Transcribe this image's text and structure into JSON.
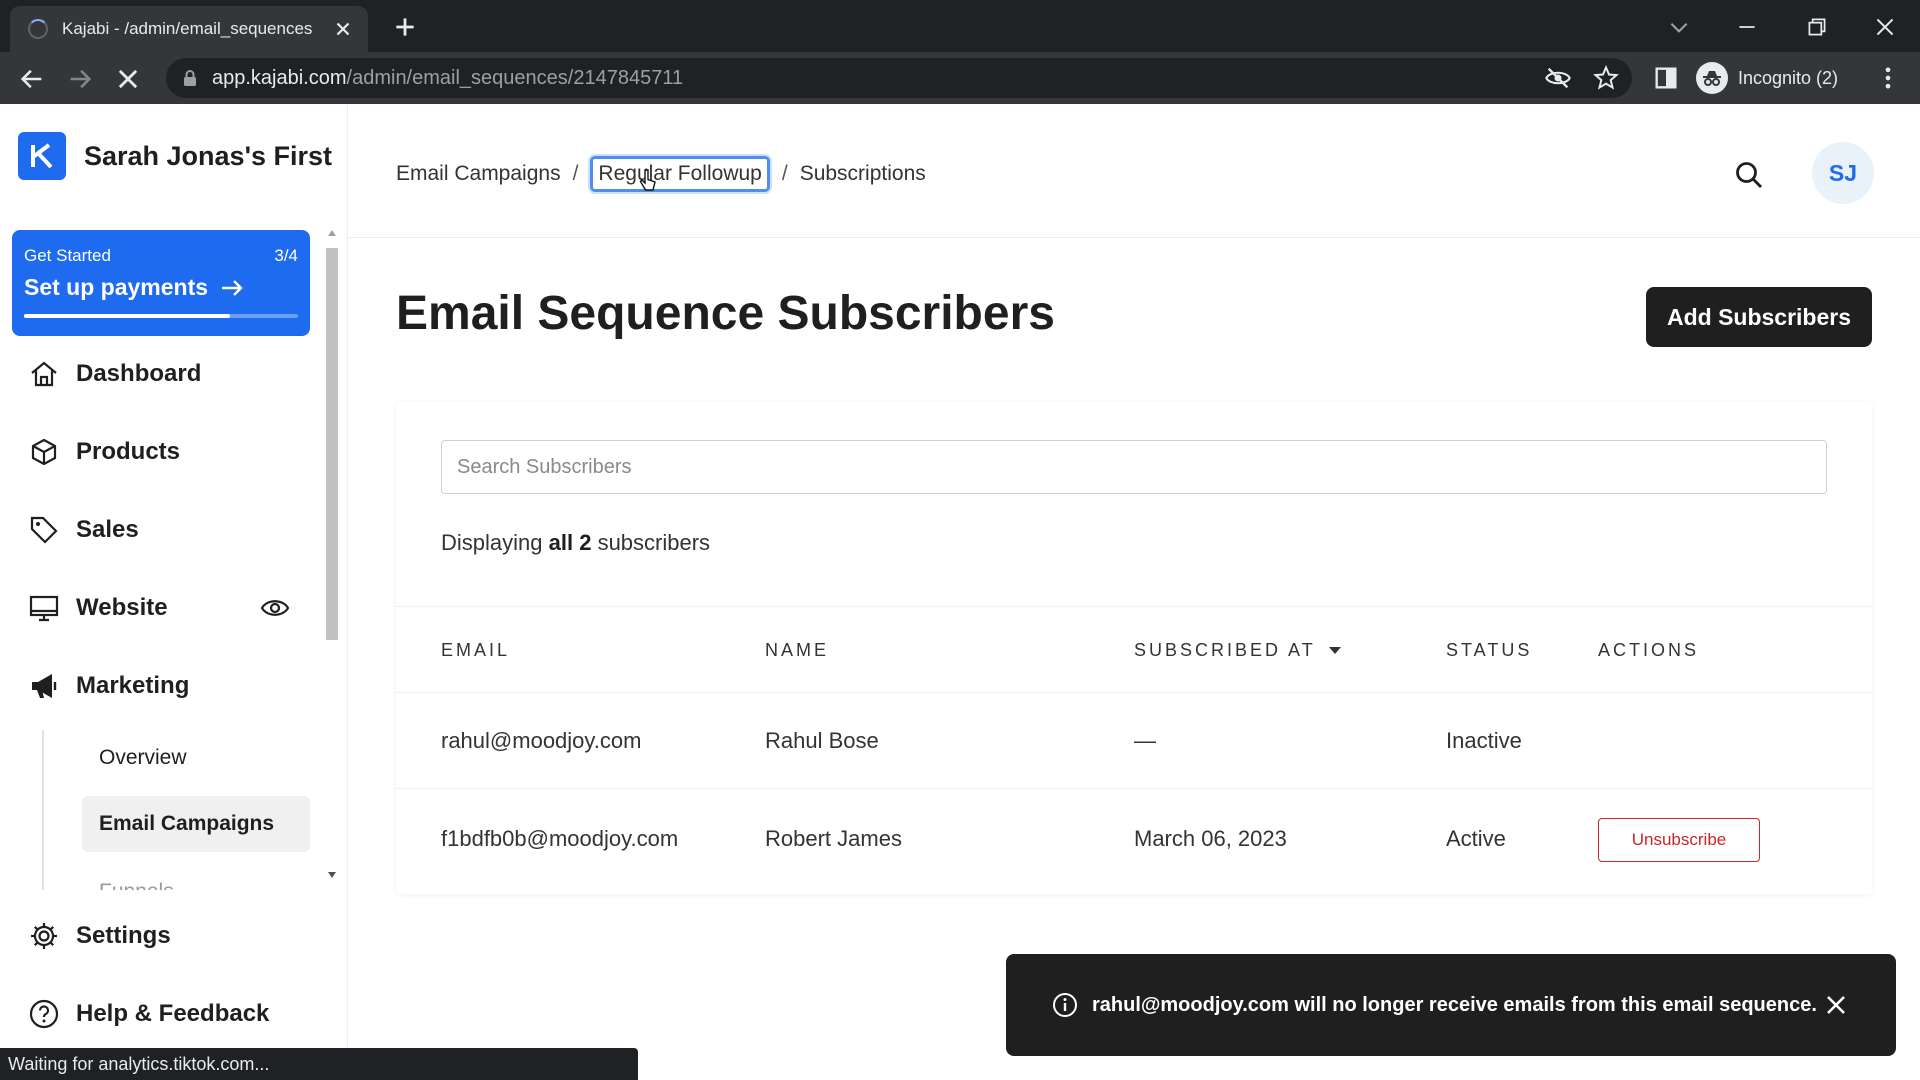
{
  "browser": {
    "tab_title": "Kajabi - /admin/email_sequences",
    "url_host": "app.kajabi.com",
    "url_path": "/admin/email_sequences/2147845711",
    "incognito_label": "Incognito (2)",
    "status_text": "Waiting for analytics.tiktok.com..."
  },
  "sidebar": {
    "site_name": "Sarah Jonas's First",
    "get_started": {
      "label": "Get Started",
      "progress": "3/4",
      "progress_fraction": 0.75,
      "cta": "Set up payments"
    },
    "nav": [
      {
        "label": "Dashboard",
        "icon": "home-icon"
      },
      {
        "label": "Products",
        "icon": "cube-icon"
      },
      {
        "label": "Sales",
        "icon": "tag-icon"
      },
      {
        "label": "Website",
        "icon": "monitor-icon"
      },
      {
        "label": "Marketing",
        "icon": "megaphone-icon"
      }
    ],
    "marketing_sub": [
      {
        "label": "Overview"
      },
      {
        "label": "Email Campaigns"
      },
      {
        "label": "Funnels"
      }
    ],
    "bottom": [
      {
        "label": "Settings",
        "icon": "gear-icon"
      },
      {
        "label": "Help & Feedback",
        "icon": "help-icon"
      }
    ]
  },
  "header": {
    "breadcrumbs": [
      "Email Campaigns",
      "Regular Followup",
      "Subscriptions"
    ],
    "separator": "/",
    "avatar_initials": "SJ"
  },
  "main": {
    "title": "Email Sequence Subscribers",
    "add_button": "Add Subscribers",
    "search_placeholder": "Search Subscribers",
    "display_prefix": "Displaying",
    "display_bold": "all 2",
    "display_suffix": "subscribers",
    "columns": [
      "EMAIL",
      "NAME",
      "SUBSCRIBED AT",
      "STATUS",
      "ACTIONS"
    ],
    "rows": [
      {
        "email": "rahul@moodjoy.com",
        "name": "Rahul Bose",
        "subscribed_at": "—",
        "status": "Inactive",
        "action": ""
      },
      {
        "email": "f1bdfb0b@moodjoy.com",
        "name": "Robert James",
        "subscribed_at": "March 06, 2023",
        "status": "Active",
        "action": "Unsubscribe"
      }
    ]
  },
  "toast": {
    "message": "rahul@moodjoy.com will no longer receive emails from this email sequence."
  },
  "colors": {
    "accent": "#1f6bf0",
    "danger": "#c62828",
    "dark": "#1f1f1f"
  }
}
